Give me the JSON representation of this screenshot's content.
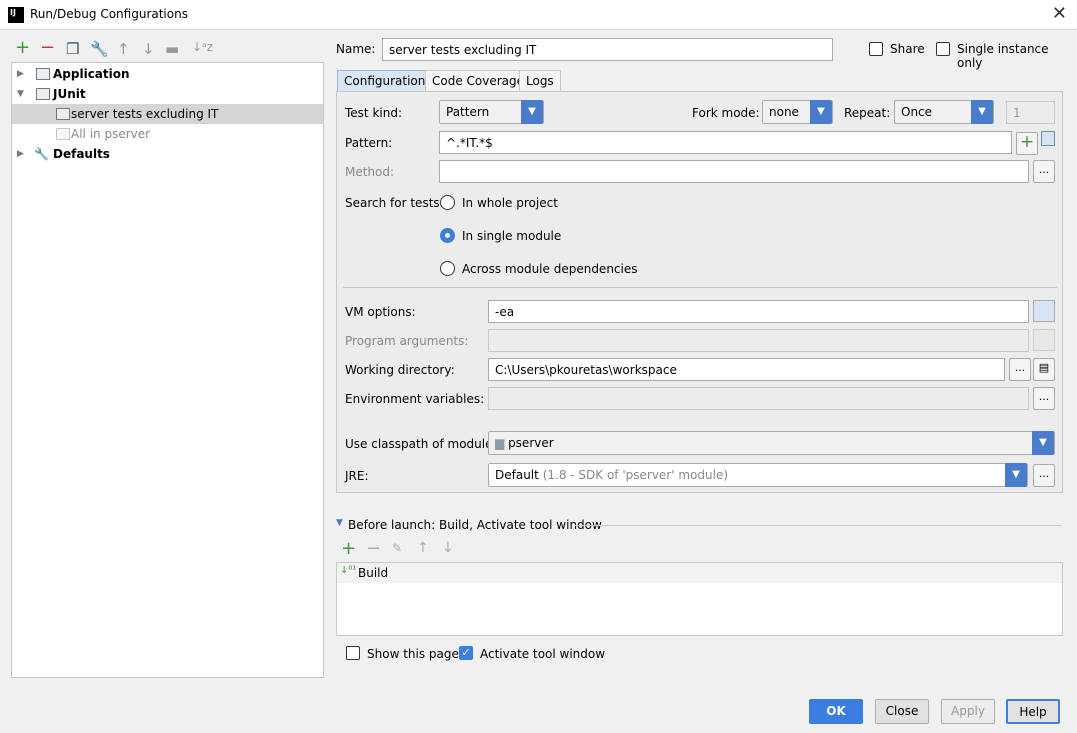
{
  "window": {
    "title": "Run/Debug Configurations",
    "logo": "IJ"
  },
  "toolbar": {
    "icons": [
      "add-icon",
      "remove-icon",
      "copy-icon",
      "wrench-icon",
      "move-up-icon",
      "move-down-icon",
      "folder-icon",
      "sort-icon"
    ]
  },
  "tree": [
    {
      "label": "Application",
      "bold": true
    },
    {
      "label": "JUnit",
      "bold": true
    },
    {
      "label": "server tests excluding IT",
      "selected": true
    },
    {
      "label": "All in pserver",
      "disabled": true
    },
    {
      "label": "Defaults",
      "bold": true
    }
  ],
  "name": {
    "label": "Name:",
    "value": "server tests excluding IT"
  },
  "share": {
    "label": "Share",
    "checked": false
  },
  "single_instance": {
    "label": "Single instance only",
    "checked": false
  },
  "tabs": [
    "Configuration",
    "Code Coverage",
    "Logs"
  ],
  "config": {
    "test_kind_label": "Test kind:",
    "test_kind": "Pattern",
    "fork_mode_label": "Fork mode:",
    "fork_mode": "none",
    "repeat_label": "Repeat:",
    "repeat": "Once",
    "repeat_count": "1",
    "pattern_label": "Pattern:",
    "pattern": "^.*IT.*$",
    "method_label": "Method:",
    "method": "",
    "search_label": "Search for tests:",
    "search_options": [
      "In whole project",
      "In single module",
      "Across module dependencies"
    ],
    "search_selected": 1,
    "vm_label": "VM options:",
    "vm": "-ea",
    "program_args_label": "Program arguments:",
    "program_args": "",
    "workdir_label": "Working directory:",
    "workdir": "C:\\Users\\pkouretas\\workspace",
    "env_label": "Environment variables:",
    "env": "",
    "classpath_label": "Use classpath of module:",
    "classpath": "pserver",
    "jre_label": "JRE:",
    "jre": "Default",
    "jre_detail": "(1.8 - SDK of 'pserver' module)",
    "ellipsis": "..."
  },
  "before_launch": {
    "title": "Before launch: Build, Activate tool window",
    "items": [
      "Build"
    ]
  },
  "show_page": {
    "label": "Show this page",
    "checked": false
  },
  "activate_tool": {
    "label": "Activate tool window",
    "checked": true
  },
  "buttons": {
    "ok": "OK",
    "close": "Close",
    "apply": "Apply",
    "help": "Help"
  }
}
